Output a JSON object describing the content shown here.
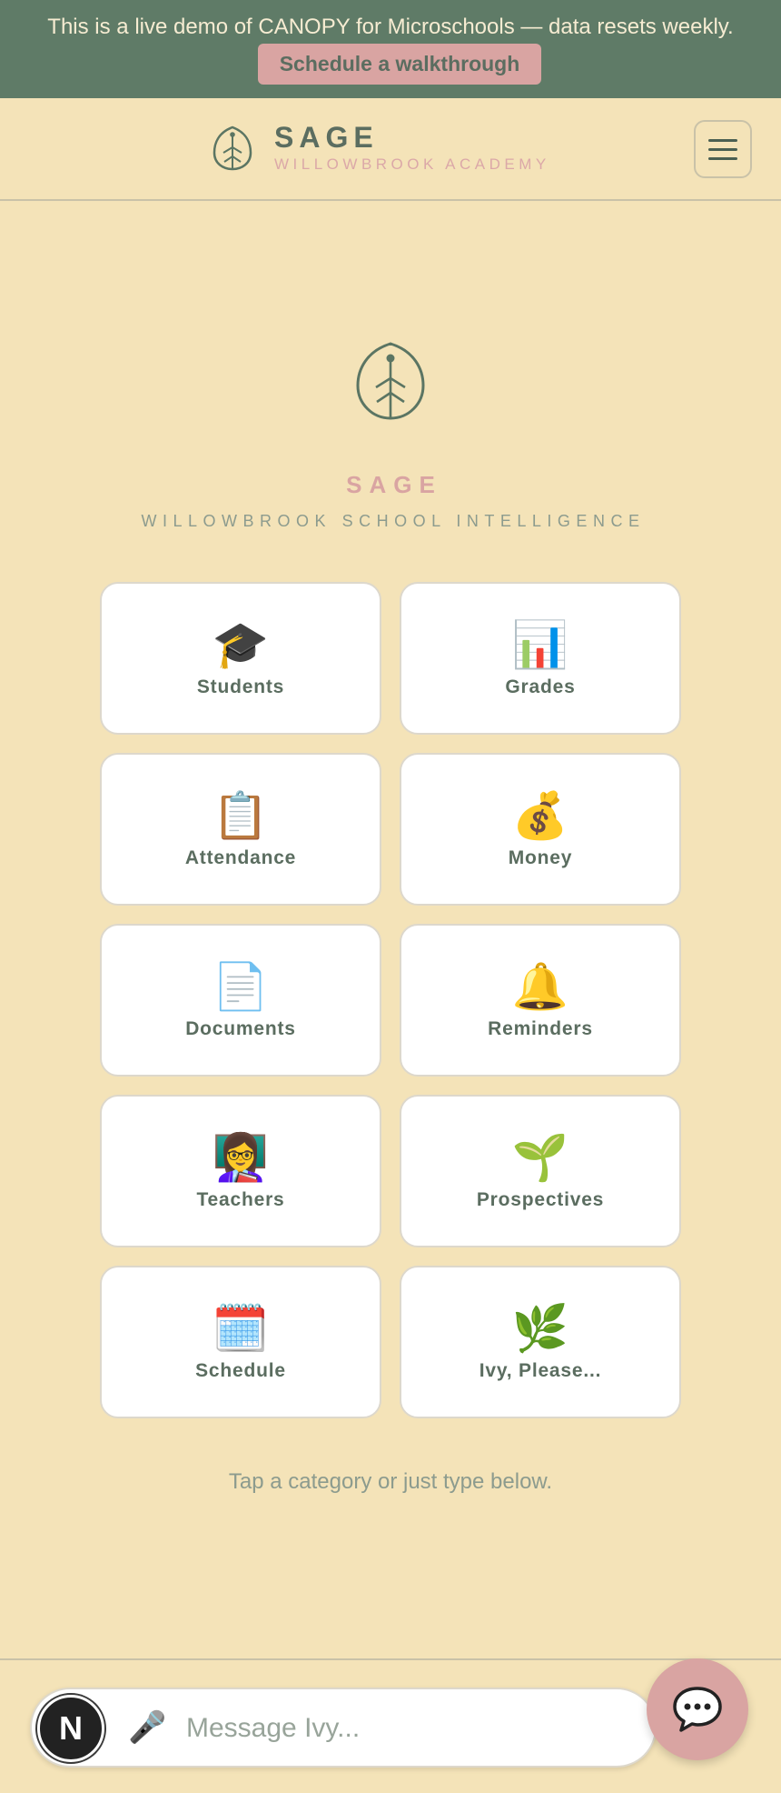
{
  "banner": {
    "text": "This is a live demo of CANOPY for Microschools — data resets weekly.",
    "cta_label": "Schedule a walkthrough"
  },
  "header": {
    "brand_name": "SAGE",
    "brand_sub": "WILLOWBROOK ACADEMY",
    "menu_icon": "hamburger-icon"
  },
  "hero": {
    "title": "SAGE",
    "subtitle": "WILLOWBROOK SCHOOL INTELLIGENCE",
    "icon": "leaf-icon"
  },
  "categories": [
    {
      "emoji": "🎓",
      "label": "Students",
      "icon": "graduation-cap-icon"
    },
    {
      "emoji": "📊",
      "label": "Grades",
      "icon": "bar-chart-icon"
    },
    {
      "emoji": "📋",
      "label": "Attendance",
      "icon": "clipboard-icon"
    },
    {
      "emoji": "💰",
      "label": "Money",
      "icon": "money-bag-icon"
    },
    {
      "emoji": "📄",
      "label": "Documents",
      "icon": "document-icon"
    },
    {
      "emoji": "🔔",
      "label": "Reminders",
      "icon": "bell-icon"
    },
    {
      "emoji": "👩‍🏫",
      "label": "Teachers",
      "icon": "teacher-icon"
    },
    {
      "emoji": "🌱",
      "label": "Prospectives",
      "icon": "seedling-icon"
    },
    {
      "emoji": "🗓️",
      "label": "Schedule",
      "icon": "calendar-icon"
    },
    {
      "emoji": "🌿",
      "label": "Ivy, Please...",
      "icon": "herb-icon"
    }
  ],
  "hint": "Tap a category or just type below.",
  "composer": {
    "avatar_letter": "N",
    "mic_emoji": "🎤",
    "placeholder": "Message Ivy...",
    "value": ""
  },
  "colors": {
    "background": "#f4e3b8",
    "banner": "#5f7b67",
    "accent_pink": "#d9a4a2",
    "text_green": "#5b6d60"
  }
}
